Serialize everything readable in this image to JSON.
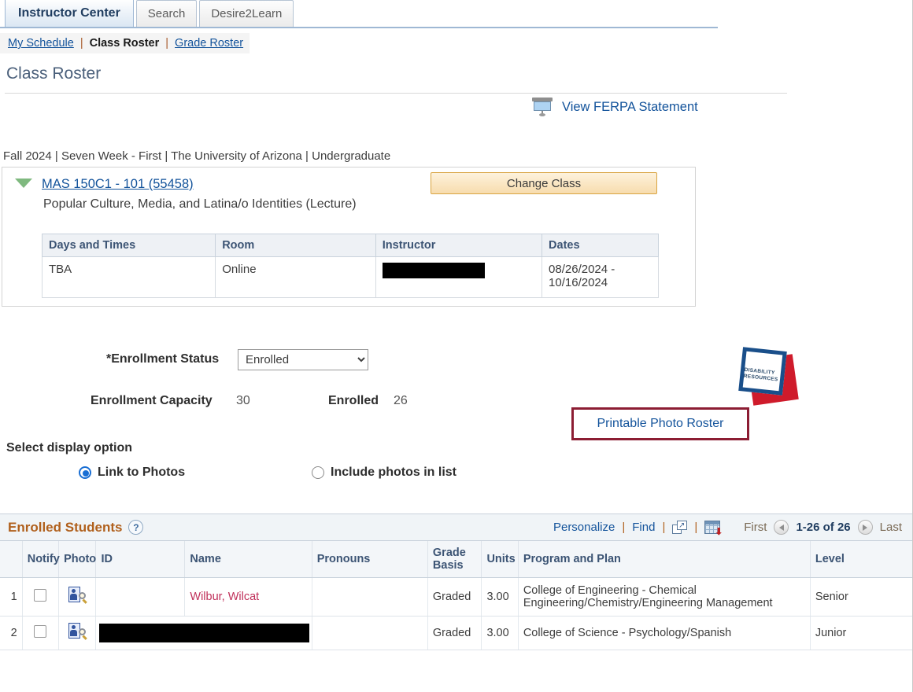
{
  "tabs": [
    {
      "label": "Instructor Center",
      "active": true
    },
    {
      "label": "Search",
      "active": false
    },
    {
      "label": "Desire2Learn",
      "active": false
    }
  ],
  "subnav": {
    "my_schedule": "My Schedule",
    "class_roster": "Class Roster",
    "grade_roster": "Grade Roster",
    "separator": "|"
  },
  "page_title": "Class Roster",
  "ferpa": {
    "label": "View FERPA Statement",
    "icon": "projector-icon"
  },
  "term_line": "Fall 2024 | Seven Week - First | The University of Arizona | Undergraduate",
  "class": {
    "code": "MAS 150C1 - 101 (55458)",
    "description": "Popular Culture, Media, and Latina/o Identities (Lecture)",
    "change_class_label": "Change Class",
    "meeting_headers": [
      "Days and Times",
      "Room",
      "Instructor",
      "Dates"
    ],
    "meeting_row": {
      "days_and_times": "TBA",
      "room": "Online",
      "instructor": "",
      "instructor_redacted": true,
      "dates": "08/26/2024 - 10/16/2024"
    }
  },
  "enrollment": {
    "status_label": "*Enrollment Status",
    "status_value": "Enrolled",
    "status_options": [
      "Enrolled"
    ],
    "capacity_label": "Enrollment Capacity",
    "capacity_value": "30",
    "enrolled_label": "Enrolled",
    "enrolled_value": "26"
  },
  "drc_logo": {
    "line1": "DISABILITY",
    "line2": "RESOURCES",
    "blue": "#1a4f8a",
    "red": "#cf1b2b"
  },
  "printable_photo_roster": {
    "label": "Printable Photo Roster",
    "border_color": "#8c1d33"
  },
  "display_option": {
    "title": "Select display option",
    "options": [
      {
        "label": "Link to Photos",
        "selected": true
      },
      {
        "label": "Include photos in list",
        "selected": false
      }
    ]
  },
  "grid": {
    "title": "Enrolled Students",
    "help_icon": "?",
    "personalize": "Personalize",
    "find": "Find",
    "separator": "|",
    "expand_icon": "expand-to-window-icon",
    "download_icon": "download-spreadsheet-icon",
    "first": "First",
    "last": "Last",
    "range": "1-26 of 26"
  },
  "roster": {
    "headers": {
      "num": "",
      "notify": "Notify",
      "photo": "Photo",
      "id": "ID",
      "name": "Name",
      "pronouns": "Pronouns",
      "grade_basis": "Grade Basis",
      "grade_basis_l1": "Grade",
      "grade_basis_l2": "Basis",
      "units": "Units",
      "program_and_plan": "Program and Plan",
      "level": "Level"
    },
    "rows": [
      {
        "num": "1",
        "id": "",
        "id_redacted": false,
        "name": "Wilbur, Wilcat",
        "name_redacted": false,
        "pronouns": "",
        "grade_basis": "Graded",
        "units": "3.00",
        "program_and_plan": "College of Engineering - Chemical Engineering/Chemistry/Engineering Management",
        "level": "Senior"
      },
      {
        "num": "2",
        "id": "",
        "id_redacted": true,
        "name": "",
        "name_redacted": true,
        "pronouns": "",
        "grade_basis": "Graded",
        "units": "3.00",
        "program_and_plan": "College of Science - Psychology/Spanish",
        "level": "Junior"
      }
    ]
  }
}
